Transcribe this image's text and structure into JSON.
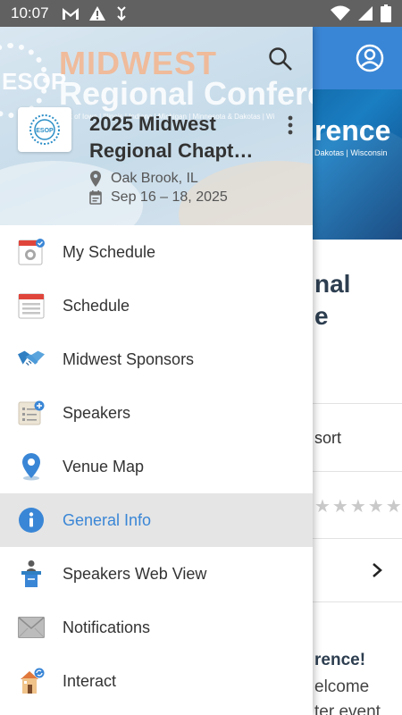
{
  "status_bar": {
    "time": "10:07"
  },
  "background_app": {
    "banner_text": "rence",
    "banner_sub": "Dakotas | Wisconsin",
    "title_line1": "nal",
    "title_line2": "e",
    "venue_fragment": "sort",
    "welcome1": "rence!",
    "welcome2": "elcome",
    "welcome3": "ter event"
  },
  "drawer": {
    "banner": {
      "logo_text": "ESOP",
      "line1": "MIDWEST",
      "line2": "Regional Conference",
      "subline": "rt of Iowa | Illinois | Indiana | Michigan | Minnesota & Dakotas | Wi"
    },
    "logo_label": "ESOP",
    "event_title_line1": "2025 Midwest",
    "event_title_line2": "Regional Chapt…",
    "location": "Oak Brook, IL",
    "dates": "Sep 16 – 18, 2025",
    "menu": [
      {
        "label": "My Schedule",
        "icon": "my-schedule-icon"
      },
      {
        "label": "Schedule",
        "icon": "calendar-icon"
      },
      {
        "label": "Midwest Sponsors",
        "icon": "handshake-icon"
      },
      {
        "label": "Speakers",
        "icon": "speakers-icon"
      },
      {
        "label": "Venue Map",
        "icon": "map-pin-icon"
      },
      {
        "label": "General Info",
        "icon": "info-icon",
        "active": true
      },
      {
        "label": "Speakers Web View",
        "icon": "podium-icon"
      },
      {
        "label": "Notifications",
        "icon": "envelope-icon"
      },
      {
        "label": "Interact",
        "icon": "interact-icon"
      }
    ]
  },
  "colors": {
    "accent": "#3a86d6",
    "active_bg": "#e5e5e5",
    "text": "#333333"
  }
}
